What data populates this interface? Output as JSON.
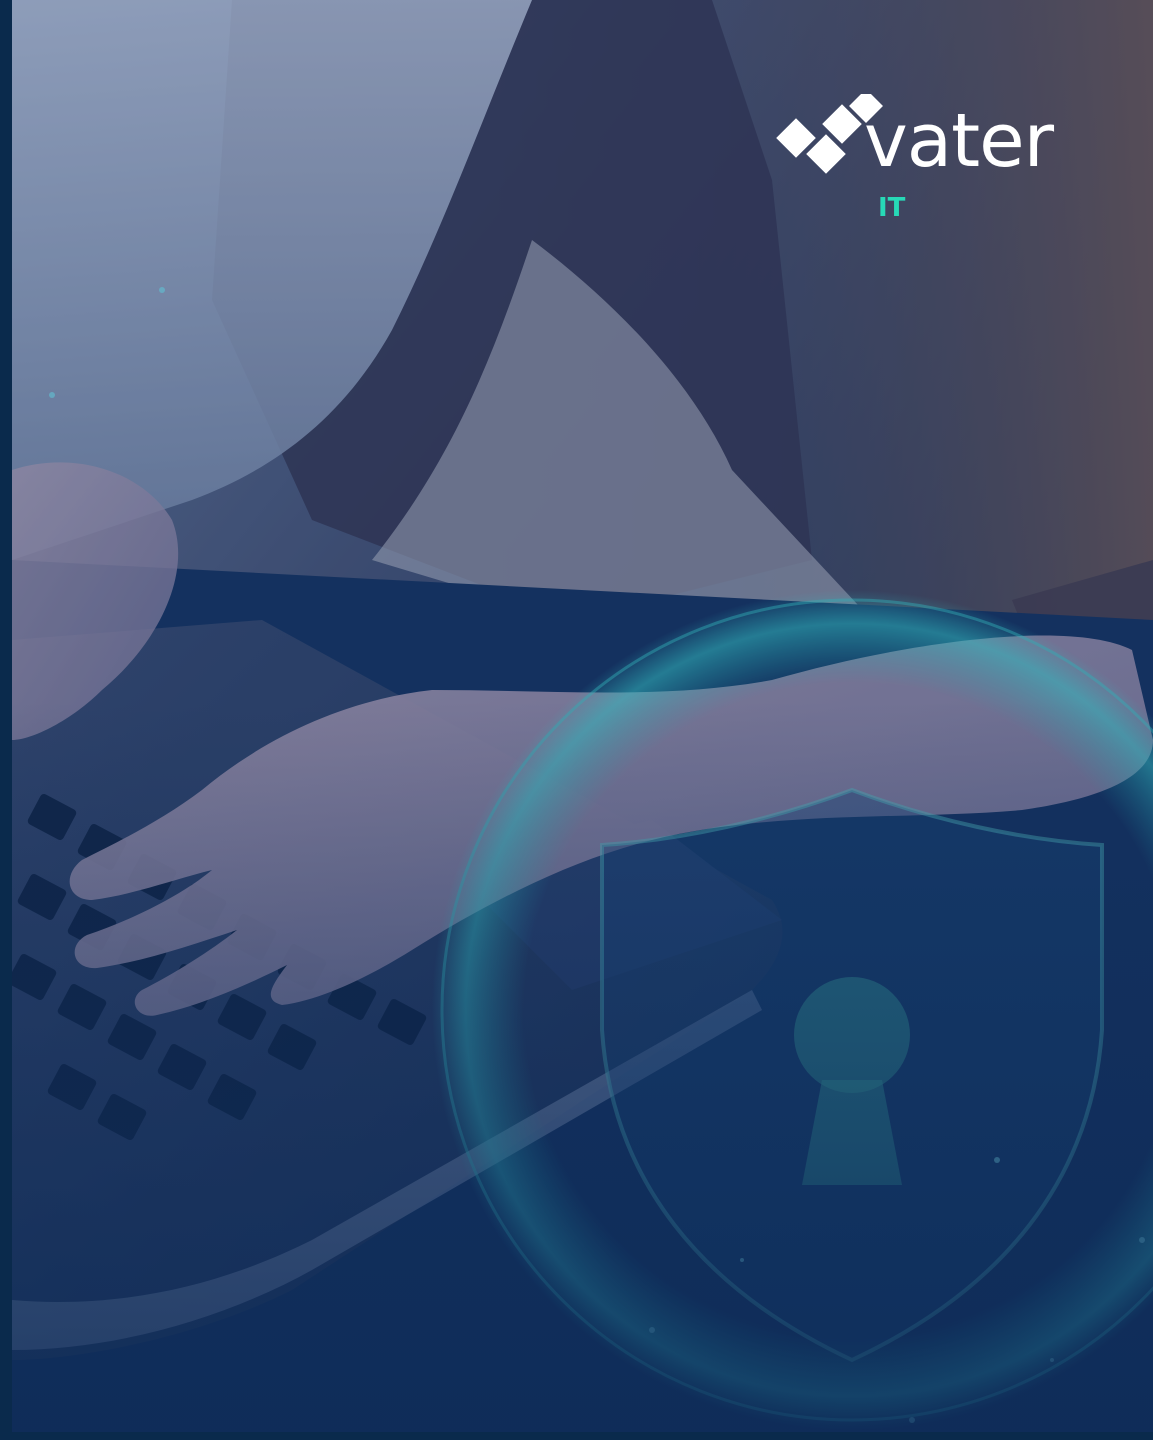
{
  "brand": {
    "name": "vater",
    "sub": "IT",
    "accent_color": "#27d9b7",
    "text_color": "#ffffff"
  },
  "scene": {
    "background_color": "#0c2c52",
    "icons": [
      "shield-lock-icon",
      "laptop",
      "hands-typing"
    ]
  }
}
